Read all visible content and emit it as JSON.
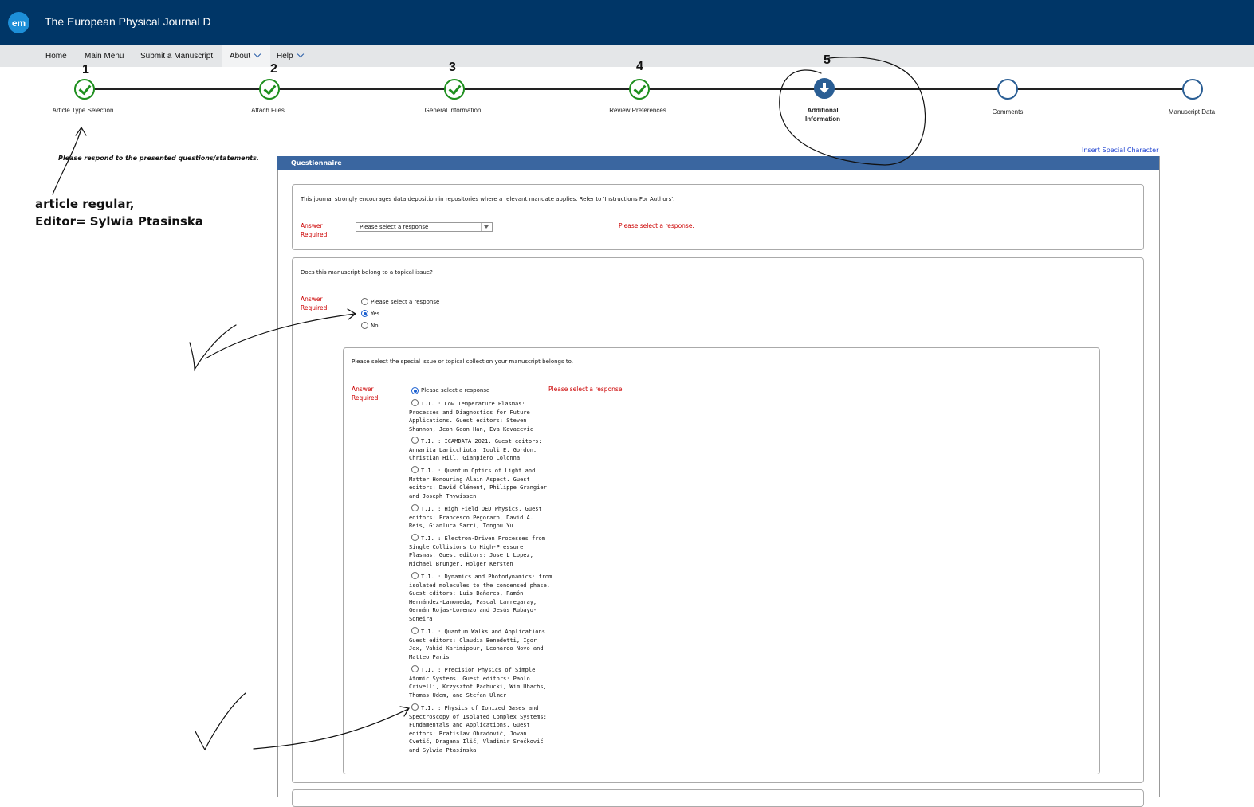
{
  "header": {
    "logo_text": "em",
    "journal_title": "The European Physical Journal D"
  },
  "menu": {
    "items": [
      "Home",
      "Main Menu",
      "Submit a Manuscript",
      "About",
      "Help"
    ]
  },
  "steps": [
    {
      "number": "1",
      "label": "Article Type Selection",
      "state": "done"
    },
    {
      "number": "2",
      "label": "Attach Files",
      "state": "done"
    },
    {
      "number": "3",
      "label": "General Information",
      "state": "done"
    },
    {
      "number": "4",
      "label": "Review Preferences",
      "state": "done"
    },
    {
      "number": "5",
      "label": "Additional Information",
      "state": "current"
    },
    {
      "number": "",
      "label": "Comments",
      "state": "todo"
    },
    {
      "number": "",
      "label": "Manuscript Data",
      "state": "todo"
    }
  ],
  "instruction": "Please respond to the presented questions/statements.",
  "insert_special_character": "Insert Special Character",
  "annotation_note": {
    "line1": "article regular,",
    "line2": "Editor= Sylwia Ptasinska"
  },
  "questionnaire": {
    "title": "Questionnaire",
    "answer_required": "Answer Required:",
    "error_text": "Please select a response.",
    "q1": {
      "text": "This journal strongly encourages data deposition in repositories where a relevant mandate applies. Refer to 'Instructions For Authors'.",
      "select_value": "Please select a response"
    },
    "q2": {
      "text": "Does this manuscript belong to a topical issue?",
      "options": [
        "Please select a response",
        "Yes",
        "No"
      ],
      "selected": "Yes"
    },
    "q3": {
      "text": "Please select the special issue or topical collection your manuscript belongs to.",
      "first_option": "Please select a response",
      "options": [
        "T.I. : Low Temperature Plasmas: Processes and Diagnostics for Future Applications. Guest editors: Steven Shannon, Jeon Geon Han, Eva Kovacevic",
        "T.I. : ICAMDATA 2021. Guest editors: Annarita Laricchiuta, Iouli E. Gordon, Christian Hill, Gianpiero Colonna",
        "T.I. : Quantum Optics of Light and Matter Honouring Alain Aspect. Guest editors: David Clément, Philippe Grangier and Joseph Thywissen",
        "T.I. : High Field QED Physics. Guest editors: Francesco Pegoraro, David A. Reis, Gianluca Sarri, Tongpu Yu",
        "T.I. : Electron-Driven Processes from Single Collisions to High-Pressure Plasmas. Guest editors: Jose L Lopez, Michael Brunger, Holger Kersten",
        "T.I. : Dynamics and Photodynamics: from isolated molecules to the condensed phase. Guest editors: Luis Bañares, Ramón Hernández-Lamoneda, Pascal Larregaray, Germán Rojas-Lorenzo and Jesús Rubayo-Soneira",
        "T.I. : Quantum Walks and Applications. Guest editors: Claudia Benedetti, Igor Jex, Vahid Karimipour, Leonardo Novo and Matteo Paris",
        "T.I. : Precision Physics of Simple Atomic Systems. Guest editors: Paolo Crivelli, Krzysztof Pachucki, Wim Ubachs, Thomas Udem, and Stefan Ulmer",
        "T.I. : Physics of Ionized Gases and Spectroscopy of Isolated Complex Systems: Fundamentals and Applications. Guest editors: Bratislav Obradović, Jovan Cvetić, Dragana Ilić, Vladimir Srećković and Sylwia Ptasinska"
      ]
    }
  }
}
